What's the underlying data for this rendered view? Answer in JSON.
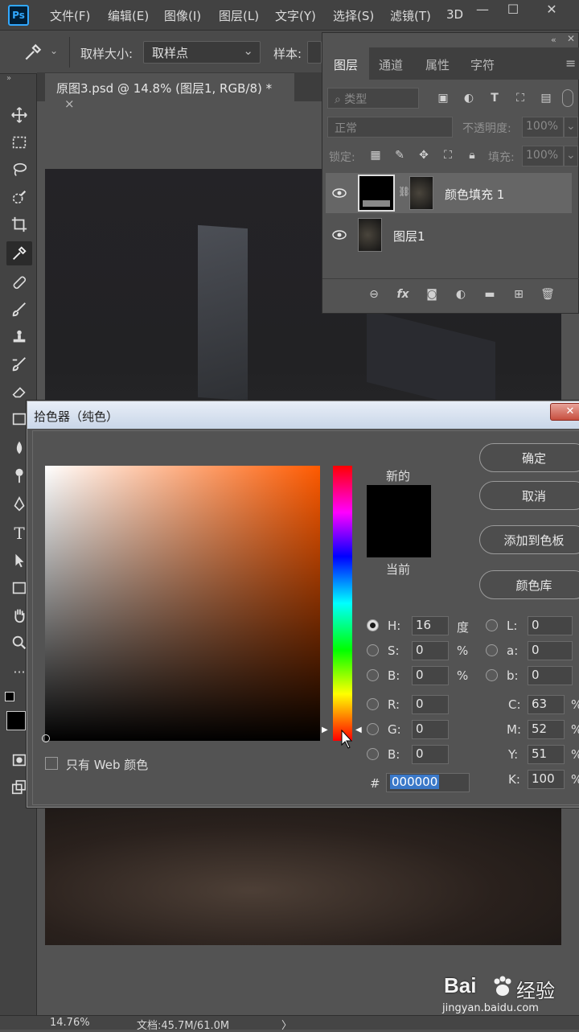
{
  "app": {
    "logo": "Ps"
  },
  "menu": [
    "文件(F)",
    "编辑(E)",
    "图像(I)",
    "图层(L)",
    "文字(Y)",
    "选择(S)",
    "滤镜(T)",
    "3D"
  ],
  "window_controls": {
    "minimize": "—",
    "maximize": "☐",
    "close": "✕"
  },
  "options_bar": {
    "sample_size_label": "取样大小:",
    "sample_size_value": "取样点",
    "sample_label": "样本:"
  },
  "document_tab": {
    "title": "原图3.psd @ 14.8% (图层1, RGB/8) *",
    "close": "×"
  },
  "layers_panel": {
    "tabs": [
      "图层",
      "通道",
      "属性",
      "字符"
    ],
    "active_tab": "图层",
    "filter_placeholder": "类型",
    "blend_mode": "正常",
    "opacity_label": "不透明度:",
    "opacity_value": "100%",
    "lock_label": "锁定:",
    "fill_label": "填充:",
    "fill_value": "100%",
    "layers": [
      {
        "name": "颜色填充 1",
        "selected": true
      },
      {
        "name": "图层1",
        "selected": false
      }
    ]
  },
  "color_picker": {
    "title": "拾色器（纯色）",
    "new_label": "新的",
    "current_label": "当前",
    "new_color": "#000000",
    "current_color": "#000000",
    "buttons": {
      "ok": "确定",
      "cancel": "取消",
      "add_swatch": "添加到色板",
      "libraries": "颜色库"
    },
    "web_only": "只有 Web 颜色",
    "hsb": [
      {
        "label": "H:",
        "value": "16",
        "unit": "度",
        "selected": true
      },
      {
        "label": "S:",
        "value": "0",
        "unit": "%",
        "selected": false
      },
      {
        "label": "B:",
        "value": "0",
        "unit": "%",
        "selected": false
      }
    ],
    "rgb": [
      {
        "label": "R:",
        "value": "0"
      },
      {
        "label": "G:",
        "value": "0"
      },
      {
        "label": "B:",
        "value": "0"
      }
    ],
    "lab": [
      {
        "label": "L:",
        "value": "0"
      },
      {
        "label": "a:",
        "value": "0"
      },
      {
        "label": "b:",
        "value": "0"
      }
    ],
    "cmyk": [
      {
        "label": "C:",
        "value": "63",
        "unit": "%"
      },
      {
        "label": "M:",
        "value": "52",
        "unit": "%"
      },
      {
        "label": "Y:",
        "value": "51",
        "unit": "%"
      },
      {
        "label": "K:",
        "value": "100",
        "unit": "%"
      }
    ],
    "hex_label": "#",
    "hex_value": "000000"
  },
  "status_bar": {
    "zoom": "14.76%",
    "doc": "文档:45.7M/61.0M",
    "arrow": "〉"
  },
  "watermark": {
    "brand": "Bai",
    "brand2": "经验",
    "url": "jingyan.baidu.com"
  },
  "colors": {
    "accent": "#31a8ff",
    "panel": "#535353",
    "chrome": "#424242"
  }
}
